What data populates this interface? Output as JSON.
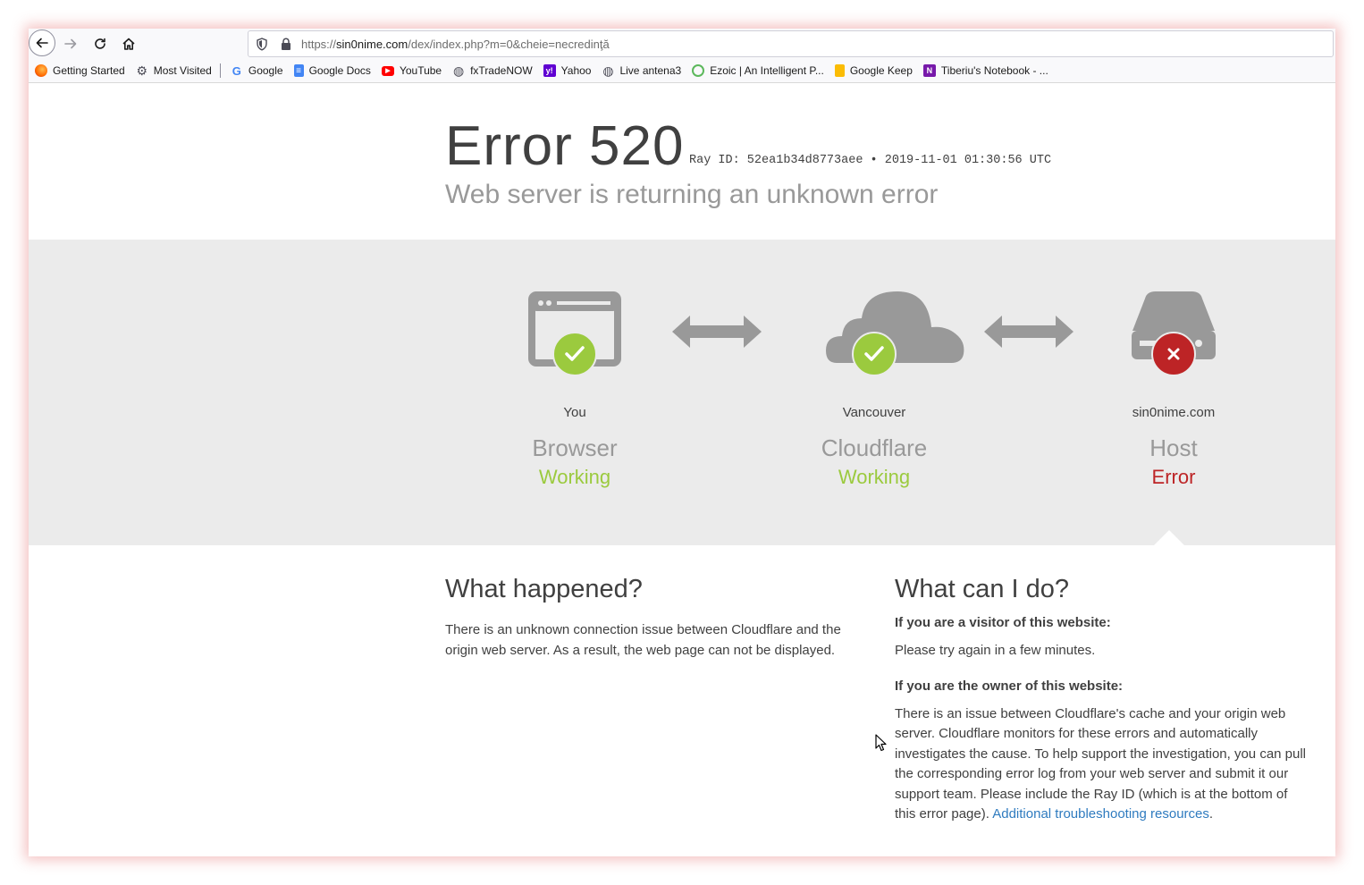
{
  "browser": {
    "url": {
      "prefix": "https://",
      "domain": "sin0nime.com",
      "path": "/dex/index.php?m=0&cheie=necredinţă"
    },
    "bookmarks": [
      {
        "label": "Getting Started",
        "icon": "firefox-icon"
      },
      {
        "label": "Most Visited",
        "icon": "gear-icon"
      },
      {
        "label": "Google",
        "icon": "google-icon"
      },
      {
        "label": "Google Docs",
        "icon": "google-docs-icon"
      },
      {
        "label": "YouTube",
        "icon": "youtube-icon"
      },
      {
        "label": "fxTradeNOW",
        "icon": "globe-icon"
      },
      {
        "label": "Yahoo",
        "icon": "yahoo-icon"
      },
      {
        "label": "Live antena3",
        "icon": "globe-icon"
      },
      {
        "label": "Ezoic | An Intelligent P...",
        "icon": "ezoic-icon"
      },
      {
        "label": "Google Keep",
        "icon": "google-keep-icon"
      },
      {
        "label": "Tiberiu's Notebook - ...",
        "icon": "onenote-icon"
      }
    ]
  },
  "error": {
    "title": "Error 520",
    "ray": "Ray ID: 52ea1b34d8773aee • 2019-11-01 01:30:56 UTC",
    "subtitle": "Web server is returning an unknown error"
  },
  "nodes": [
    {
      "place": "You",
      "role": "Browser",
      "status": "Working",
      "status_color": "#9bca3e"
    },
    {
      "place": "Vancouver",
      "role": "Cloudflare",
      "status": "Working",
      "status_color": "#9bca3e"
    },
    {
      "place": "sin0nime.com",
      "role": "Host",
      "status": "Error",
      "status_color": "#bd2426"
    }
  ],
  "what_happened": {
    "heading": "What happened?",
    "body": "There is an unknown connection issue between Cloudflare and the origin web server. As a result, the web page can not be displayed."
  },
  "what_can_i_do": {
    "heading": "What can I do?",
    "visitor_heading": "If you are a visitor of this website:",
    "visitor_body": "Please try again in a few minutes.",
    "owner_heading": "If you are the owner of this website:",
    "owner_body": "There is an issue between Cloudflare's cache and your origin web server. Cloudflare monitors for these errors and automatically investigates the cause. To help support the investigation, you can pull the corresponding error log from your web server and submit it our support team. Please include the Ray ID (which is at the bottom of this error page).",
    "link_text": "Additional troubleshooting resources",
    "trailing": "."
  },
  "colors": {
    "ok": "#9bca3e",
    "error": "#bd2426",
    "icon_gray": "#999999",
    "band": "#ebebeb",
    "link": "#2f7bbf"
  }
}
